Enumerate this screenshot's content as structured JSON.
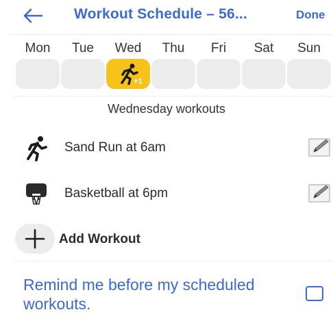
{
  "header": {
    "title": "Workout Schedule – 56...",
    "done_label": "Done",
    "back_icon": "arrow-left-icon"
  },
  "week": {
    "days": [
      "Mon",
      "Tue",
      "Wed",
      "Thu",
      "Fri",
      "Sat",
      "Sun"
    ],
    "selected_day": "Wed",
    "selected_badge": "+1",
    "selected_color": "#f6c21b"
  },
  "section": {
    "title": "Wednesday workouts"
  },
  "workouts": [
    {
      "label": "Sand Run at 6am",
      "icon": "running-icon"
    },
    {
      "label": "Basketball at 6pm",
      "icon": "basketball-icon"
    }
  ],
  "add": {
    "label": "Add Workout",
    "icon": "plus-icon"
  },
  "reminder": {
    "text": "Remind me before my scheduled workouts.",
    "checked": false
  },
  "colors": {
    "accent": "#3a6ad0",
    "cell": "#ececec"
  }
}
